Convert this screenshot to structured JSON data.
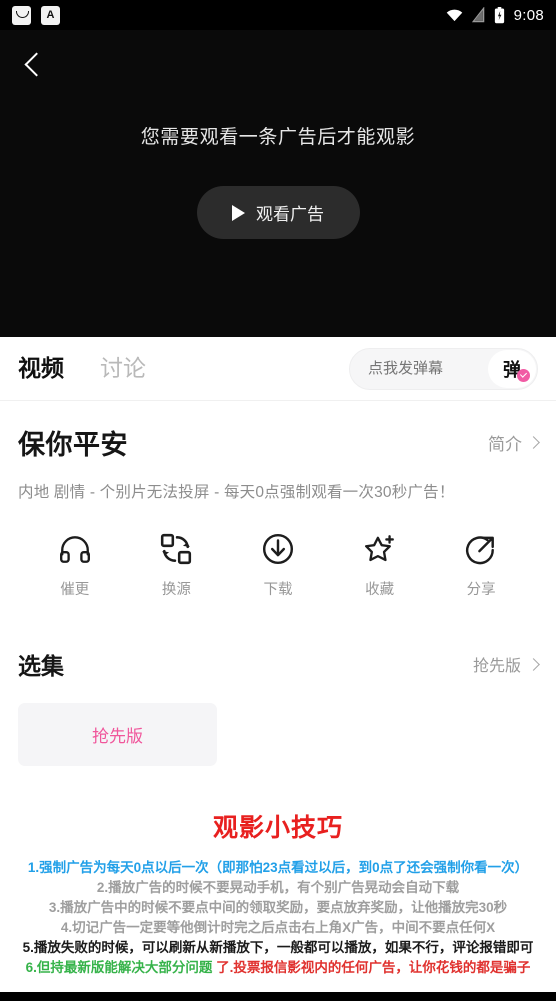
{
  "statusbar": {
    "time": "9:08",
    "icons": [
      "smile-app-icon",
      "letter-a-app-icon",
      "wifi-icon",
      "signal-icon",
      "battery-charging-icon"
    ]
  },
  "video": {
    "back_icon": "back-chevron-icon",
    "ad_message": "您需要观看一条广告后才能观影",
    "watch_ad_button": "观看广告",
    "play_icon": "play-triangle-icon"
  },
  "tabs": [
    {
      "label": "视频",
      "active": true
    },
    {
      "label": "讨论",
      "active": false
    }
  ],
  "danmaku": {
    "placeholder": "点我发弹幕",
    "toggle_label": "弹",
    "badge_icon": "check-badge-icon",
    "badge_color": "#f15ba4"
  },
  "movie": {
    "title": "保你平安",
    "intro_label": "简介",
    "subtitle": "内地  剧情 - 个别片无法投屏 - 每天0点强制观看一次30秒广告！"
  },
  "actions": [
    {
      "label": "催更",
      "icon": "headphones-icon"
    },
    {
      "label": "换源",
      "icon": "swap-source-icon"
    },
    {
      "label": "下载",
      "icon": "download-circle-icon"
    },
    {
      "label": "收藏",
      "icon": "star-plus-icon"
    },
    {
      "label": "分享",
      "icon": "share-circle-arrow-icon"
    }
  ],
  "episodes": {
    "section_title": "选集",
    "more_label": "抢先版",
    "items": [
      {
        "label": "抢先版"
      }
    ]
  },
  "tips": {
    "title": "观影小技巧",
    "title_color": "#e8201f",
    "lines": [
      {
        "text": "1.强制广告为每天0点以后一次（即那怕23点看过以后，到0点了还会强制你看一次）",
        "color": "#22a0e8"
      },
      {
        "text": "2.播放广告的时候不要晃动手机，有个别广告晃动会自动下载",
        "color": "#9e9e9e"
      },
      {
        "text": "3.播放广告中的时候不要点中间的领取奖励，要点放弃奖励，让他播放完30秒",
        "color": "#9e9e9e"
      },
      {
        "text": "4.切记广告一定要等他倒计时完之后点击右上角X广告，中间不要点任何X",
        "color": "#9e9e9e"
      },
      {
        "text": "5.播放失败的时候，可以刷新从新播放下，一般都可以播放，如果不行，评论报错即可",
        "color": "#1b1b1b"
      }
    ],
    "last_line": {
      "green_text": "6.但持最新版能解决大部分问题",
      "red_text": "了.投票报信影视内的任何广告，让你花钱的都是骗子"
    }
  }
}
